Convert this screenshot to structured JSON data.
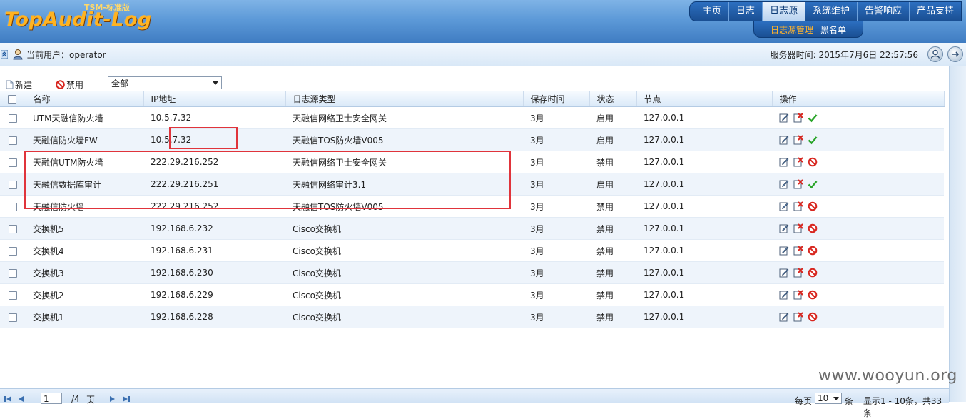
{
  "header": {
    "edition": "TSM-标准版",
    "logo": "TopAudit-Log",
    "nav": [
      "主页",
      "日志",
      "日志源",
      "系统维护",
      "告警响应",
      "产品支持"
    ],
    "nav_active": "日志源",
    "subnav": [
      "日志源管理",
      "黑名单"
    ],
    "subnav_active": "日志源管理"
  },
  "userbar": {
    "user_label": "当前用户：operator",
    "server_time": "服务器时间:  2015年7月6日  22:57:56"
  },
  "toolbar": {
    "new_label": "新建",
    "disable_label": "禁用",
    "filter_value": "全部"
  },
  "table": {
    "columns": [
      "名称",
      "IP地址",
      "日志源类型",
      "保存时间",
      "状态",
      "节点",
      "操作"
    ],
    "rows": [
      {
        "name": "UTM天融信防火墙",
        "ip": "10.5.7.32",
        "type": "天融信网络卫士安全网关",
        "retention": "3月",
        "status": "启用",
        "node": "127.0.0.1"
      },
      {
        "name": "天融信防火墙FW",
        "ip": "10.5.7.32",
        "type": "天融信TOS防火墙V005",
        "retention": "3月",
        "status": "启用",
        "node": "127.0.0.1"
      },
      {
        "name": "天融信UTM防火墙",
        "ip": "222.29.216.252",
        "type": "天融信网络卫士安全网关",
        "retention": "3月",
        "status": "禁用",
        "node": "127.0.0.1"
      },
      {
        "name": "天融信数据库审计",
        "ip": "222.29.216.251",
        "type": "天融信网络审计3.1",
        "retention": "3月",
        "status": "启用",
        "node": "127.0.0.1"
      },
      {
        "name": "天融信防火墙",
        "ip": "222.29.216.252",
        "type": "天融信TOS防火墙V005",
        "retention": "3月",
        "status": "禁用",
        "node": "127.0.0.1"
      },
      {
        "name": "交换机5",
        "ip": "192.168.6.232",
        "type": "Cisco交换机",
        "retention": "3月",
        "status": "禁用",
        "node": "127.0.0.1"
      },
      {
        "name": "交换机4",
        "ip": "192.168.6.231",
        "type": "Cisco交换机",
        "retention": "3月",
        "status": "禁用",
        "node": "127.0.0.1"
      },
      {
        "name": "交换机3",
        "ip": "192.168.6.230",
        "type": "Cisco交换机",
        "retention": "3月",
        "status": "禁用",
        "node": "127.0.0.1"
      },
      {
        "name": "交换机2",
        "ip": "192.168.6.229",
        "type": "Cisco交换机",
        "retention": "3月",
        "status": "禁用",
        "node": "127.0.0.1"
      },
      {
        "name": "交换机1",
        "ip": "192.168.6.228",
        "type": "Cisco交换机",
        "retention": "3月",
        "status": "禁用",
        "node": "127.0.0.1"
      }
    ]
  },
  "pager": {
    "page_value": "1",
    "total_pages": "/4",
    "page_unit": "页",
    "per_page_prefix": "每页",
    "per_page_value": "10",
    "per_page_suffix": "条",
    "summary": "显示1 - 10条，共33条"
  },
  "watermark": "www.wooyun.org",
  "colors": {
    "header_blue": "#3f7cc2",
    "logo_orange": "#ffb321",
    "highlight_red": "#e0343b",
    "enabled_green": "#2aa52a",
    "disabled_red": "#d8261f"
  }
}
